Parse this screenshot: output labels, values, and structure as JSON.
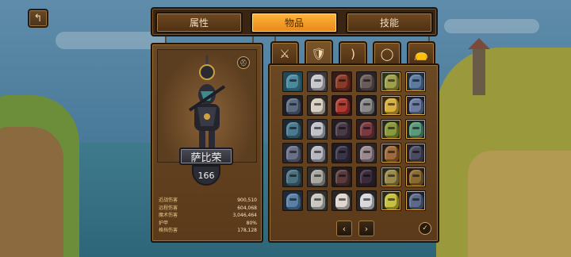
{
  "header": {
    "back_icon": "back-arrow-icon",
    "tabs": [
      {
        "label": "属性",
        "active": false
      },
      {
        "label": "物品",
        "active": true
      },
      {
        "label": "技能",
        "active": false
      }
    ]
  },
  "hero": {
    "name": "萨比荣",
    "level": "166",
    "stats": [
      {
        "label": "近战伤害",
        "value": "900,510"
      },
      {
        "label": "远程伤害",
        "value": "604,068"
      },
      {
        "label": "魔术伤害",
        "value": "3,046,464"
      },
      {
        "label": "护甲",
        "value": "80%"
      },
      {
        "label": "格挡伤害",
        "value": "178,128"
      }
    ]
  },
  "inventory": {
    "category_icons": [
      "crossed-swords-icon",
      "armor-icon",
      "bow-icon",
      "ring-icon",
      "bag-icon"
    ],
    "active_category": 1,
    "item_count": 36
  },
  "colors": {
    "accent": "#ffb63a",
    "panel": "#5a3a1a",
    "text": "#e8c88a"
  }
}
